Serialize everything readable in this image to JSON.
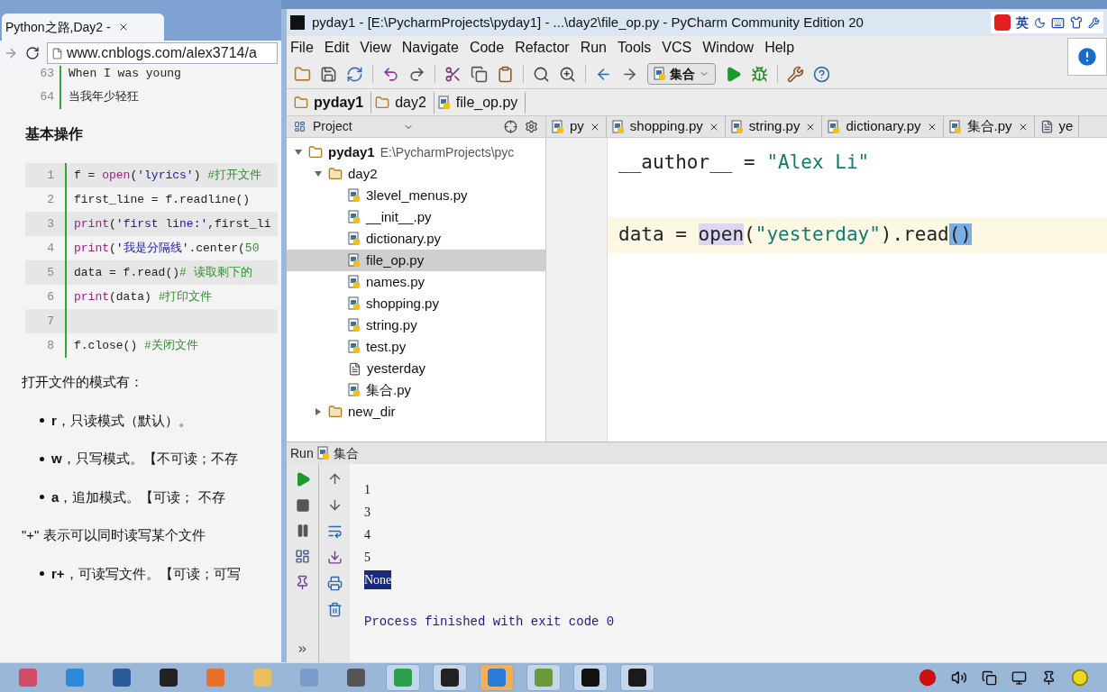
{
  "browser": {
    "tab_title": "Python之路,Day2 -",
    "url": "www.cnblogs.com/alex3714/a",
    "lyric_lines": [
      {
        "number": "63",
        "text": "When I was young"
      },
      {
        "number": "64",
        "text": "当我年少轻狂"
      }
    ],
    "heading": "基本操作",
    "code_lines": [
      {
        "number": "1",
        "segments": [
          {
            "kind": "plain",
            "text": "f = "
          },
          {
            "kind": "builtin",
            "text": "open"
          },
          {
            "kind": "plain",
            "text": "("
          },
          {
            "kind": "string",
            "text": "'lyrics'"
          },
          {
            "kind": "plain",
            "text": ") "
          },
          {
            "kind": "comment",
            "text": "#打开文件"
          }
        ]
      },
      {
        "number": "2",
        "segments": [
          {
            "kind": "plain",
            "text": "first_line = f.readline()"
          }
        ]
      },
      {
        "number": "3",
        "segments": [
          {
            "kind": "builtin",
            "text": "print"
          },
          {
            "kind": "plain",
            "text": "("
          },
          {
            "kind": "string",
            "text": "'first line:'"
          },
          {
            "kind": "plain",
            "text": ",first_li"
          }
        ]
      },
      {
        "number": "4",
        "segments": [
          {
            "kind": "builtin",
            "text": "print"
          },
          {
            "kind": "plain",
            "text": "("
          },
          {
            "kind": "string",
            "text": "'我是分隔线'"
          },
          {
            "kind": "plain",
            "text": ".center("
          },
          {
            "kind": "comment",
            "text": "50"
          }
        ]
      },
      {
        "number": "5",
        "segments": [
          {
            "kind": "plain",
            "text": "data = f.read()"
          },
          {
            "kind": "comment",
            "text": "# 读取剩下的"
          }
        ]
      },
      {
        "number": "6",
        "segments": [
          {
            "kind": "builtin",
            "text": "print"
          },
          {
            "kind": "plain",
            "text": "(data) "
          },
          {
            "kind": "comment",
            "text": "#打印文件"
          }
        ]
      },
      {
        "number": "7"
      },
      {
        "number": "8",
        "segments": [
          {
            "kind": "plain",
            "text": "f.close() "
          },
          {
            "kind": "comment",
            "text": "#关闭文件"
          }
        ]
      }
    ],
    "modes_intro": "打开文件的模式有：",
    "modes": [
      {
        "mode": "r",
        "text": "，只读模式（默认）。"
      },
      {
        "mode": "w",
        "text": "，只写模式。【不可读；不存"
      },
      {
        "mode": "a",
        "text": "，追加模式。【可读；  不存"
      }
    ],
    "plus_note": "\"+\" 表示可以同时读写某个文件",
    "plus_modes": [
      {
        "mode": "r+",
        "text": "，可读写文件。【可读；可写"
      }
    ]
  },
  "pycharm": {
    "title": "pyday1 - [E:\\PycharmProjects\\pyday1] - ...\\day2\\file_op.py - PyCharm Community Edition 20",
    "ime_label": "英",
    "menu": [
      "File",
      "Edit",
      "View",
      "Navigate",
      "Code",
      "Refactor",
      "Run",
      "Tools",
      "VCS",
      "Window",
      "Help"
    ],
    "run_config": "集合",
    "breadcrumbs": [
      "pyday1",
      "day2",
      "file_op.py"
    ],
    "project_label": "Project",
    "editor_tabs": [
      {
        "label": "py",
        "kind": "python",
        "selected": false
      },
      {
        "label": "shopping.py",
        "kind": "python",
        "selected": false
      },
      {
        "label": "string.py",
        "kind": "python",
        "selected": false
      },
      {
        "label": "dictionary.py",
        "kind": "python",
        "selected": false
      },
      {
        "label": "集合.py",
        "kind": "python",
        "selected": false
      },
      {
        "label": "ye",
        "kind": "text",
        "selected": false
      }
    ],
    "tree": [
      {
        "label": "pyday1",
        "path": "E:\\PycharmProjects\\pyc",
        "kind": "root",
        "expanded": true,
        "selected": false,
        "children": [
          {
            "label": "day2",
            "kind": "folder",
            "expanded": true,
            "selected": false,
            "children": [
              {
                "label": "3level_menus.py",
                "kind": "python",
                "selected": false
              },
              {
                "label": "__init__.py",
                "kind": "python",
                "selected": false
              },
              {
                "label": "dictionary.py",
                "kind": "python",
                "selected": false
              },
              {
                "label": "file_op.py",
                "kind": "python",
                "selected": true
              },
              {
                "label": "names.py",
                "kind": "python",
                "selected": false
              },
              {
                "label": "shopping.py",
                "kind": "python",
                "selected": false
              },
              {
                "label": "string.py",
                "kind": "python",
                "selected": false
              },
              {
                "label": "test.py",
                "kind": "python",
                "selected": false
              },
              {
                "label": "yesterday",
                "kind": "text",
                "selected": false
              },
              {
                "label": "集合.py",
                "kind": "python",
                "selected": false
              }
            ]
          },
          {
            "label": "new_dir",
            "kind": "folder",
            "expanded": false,
            "selected": false
          }
        ]
      }
    ],
    "editor_lines": [
      {
        "current": false,
        "segments": [
          {
            "kind": "plain",
            "text": "__author__ = "
          },
          {
            "kind": "string",
            "text": "\"Alex Li\""
          }
        ]
      },
      {
        "current": false
      },
      {
        "current": true,
        "segments": [
          {
            "kind": "plain",
            "text": "data = "
          },
          {
            "kind": "call_highlight",
            "text": "open"
          },
          {
            "kind": "plain",
            "text": "("
          },
          {
            "kind": "string",
            "text": "\"yesterday\""
          },
          {
            "kind": "plain",
            "text": ").read"
          },
          {
            "kind": "brace_match",
            "text": "()"
          }
        ]
      }
    ],
    "run_panel": {
      "label": "Run",
      "config": "集合",
      "output": [
        {
          "text": "1",
          "selected": false
        },
        {
          "text": "3",
          "selected": false
        },
        {
          "text": "4",
          "selected": false
        },
        {
          "text": "5",
          "selected": false
        },
        {
          "text": "None",
          "selected": true
        }
      ],
      "exit_message": "Process finished with exit code 0"
    }
  },
  "taskbar": {
    "apps": [
      {
        "kind": "start",
        "open": false,
        "selected": false
      },
      {
        "kind": "ie",
        "open": false,
        "selected": false
      },
      {
        "kind": "photos",
        "open": false,
        "selected": false
      },
      {
        "kind": "qq",
        "open": false,
        "selected": false
      },
      {
        "kind": "firefox",
        "open": false,
        "selected": false
      },
      {
        "kind": "explorer",
        "open": false,
        "selected": false
      },
      {
        "kind": "magnifier",
        "open": false,
        "selected": false
      },
      {
        "kind": "disk",
        "open": false,
        "selected": false
      },
      {
        "kind": "chrome",
        "open": true,
        "selected": false
      },
      {
        "kind": "tool",
        "open": true,
        "selected": false
      },
      {
        "kind": "browser",
        "open": true,
        "selected": true
      },
      {
        "kind": "notepad",
        "open": true,
        "selected": false
      },
      {
        "kind": "terminal",
        "open": true,
        "selected": false
      },
      {
        "kind": "pycharm",
        "open": true,
        "selected": false
      }
    ]
  }
}
